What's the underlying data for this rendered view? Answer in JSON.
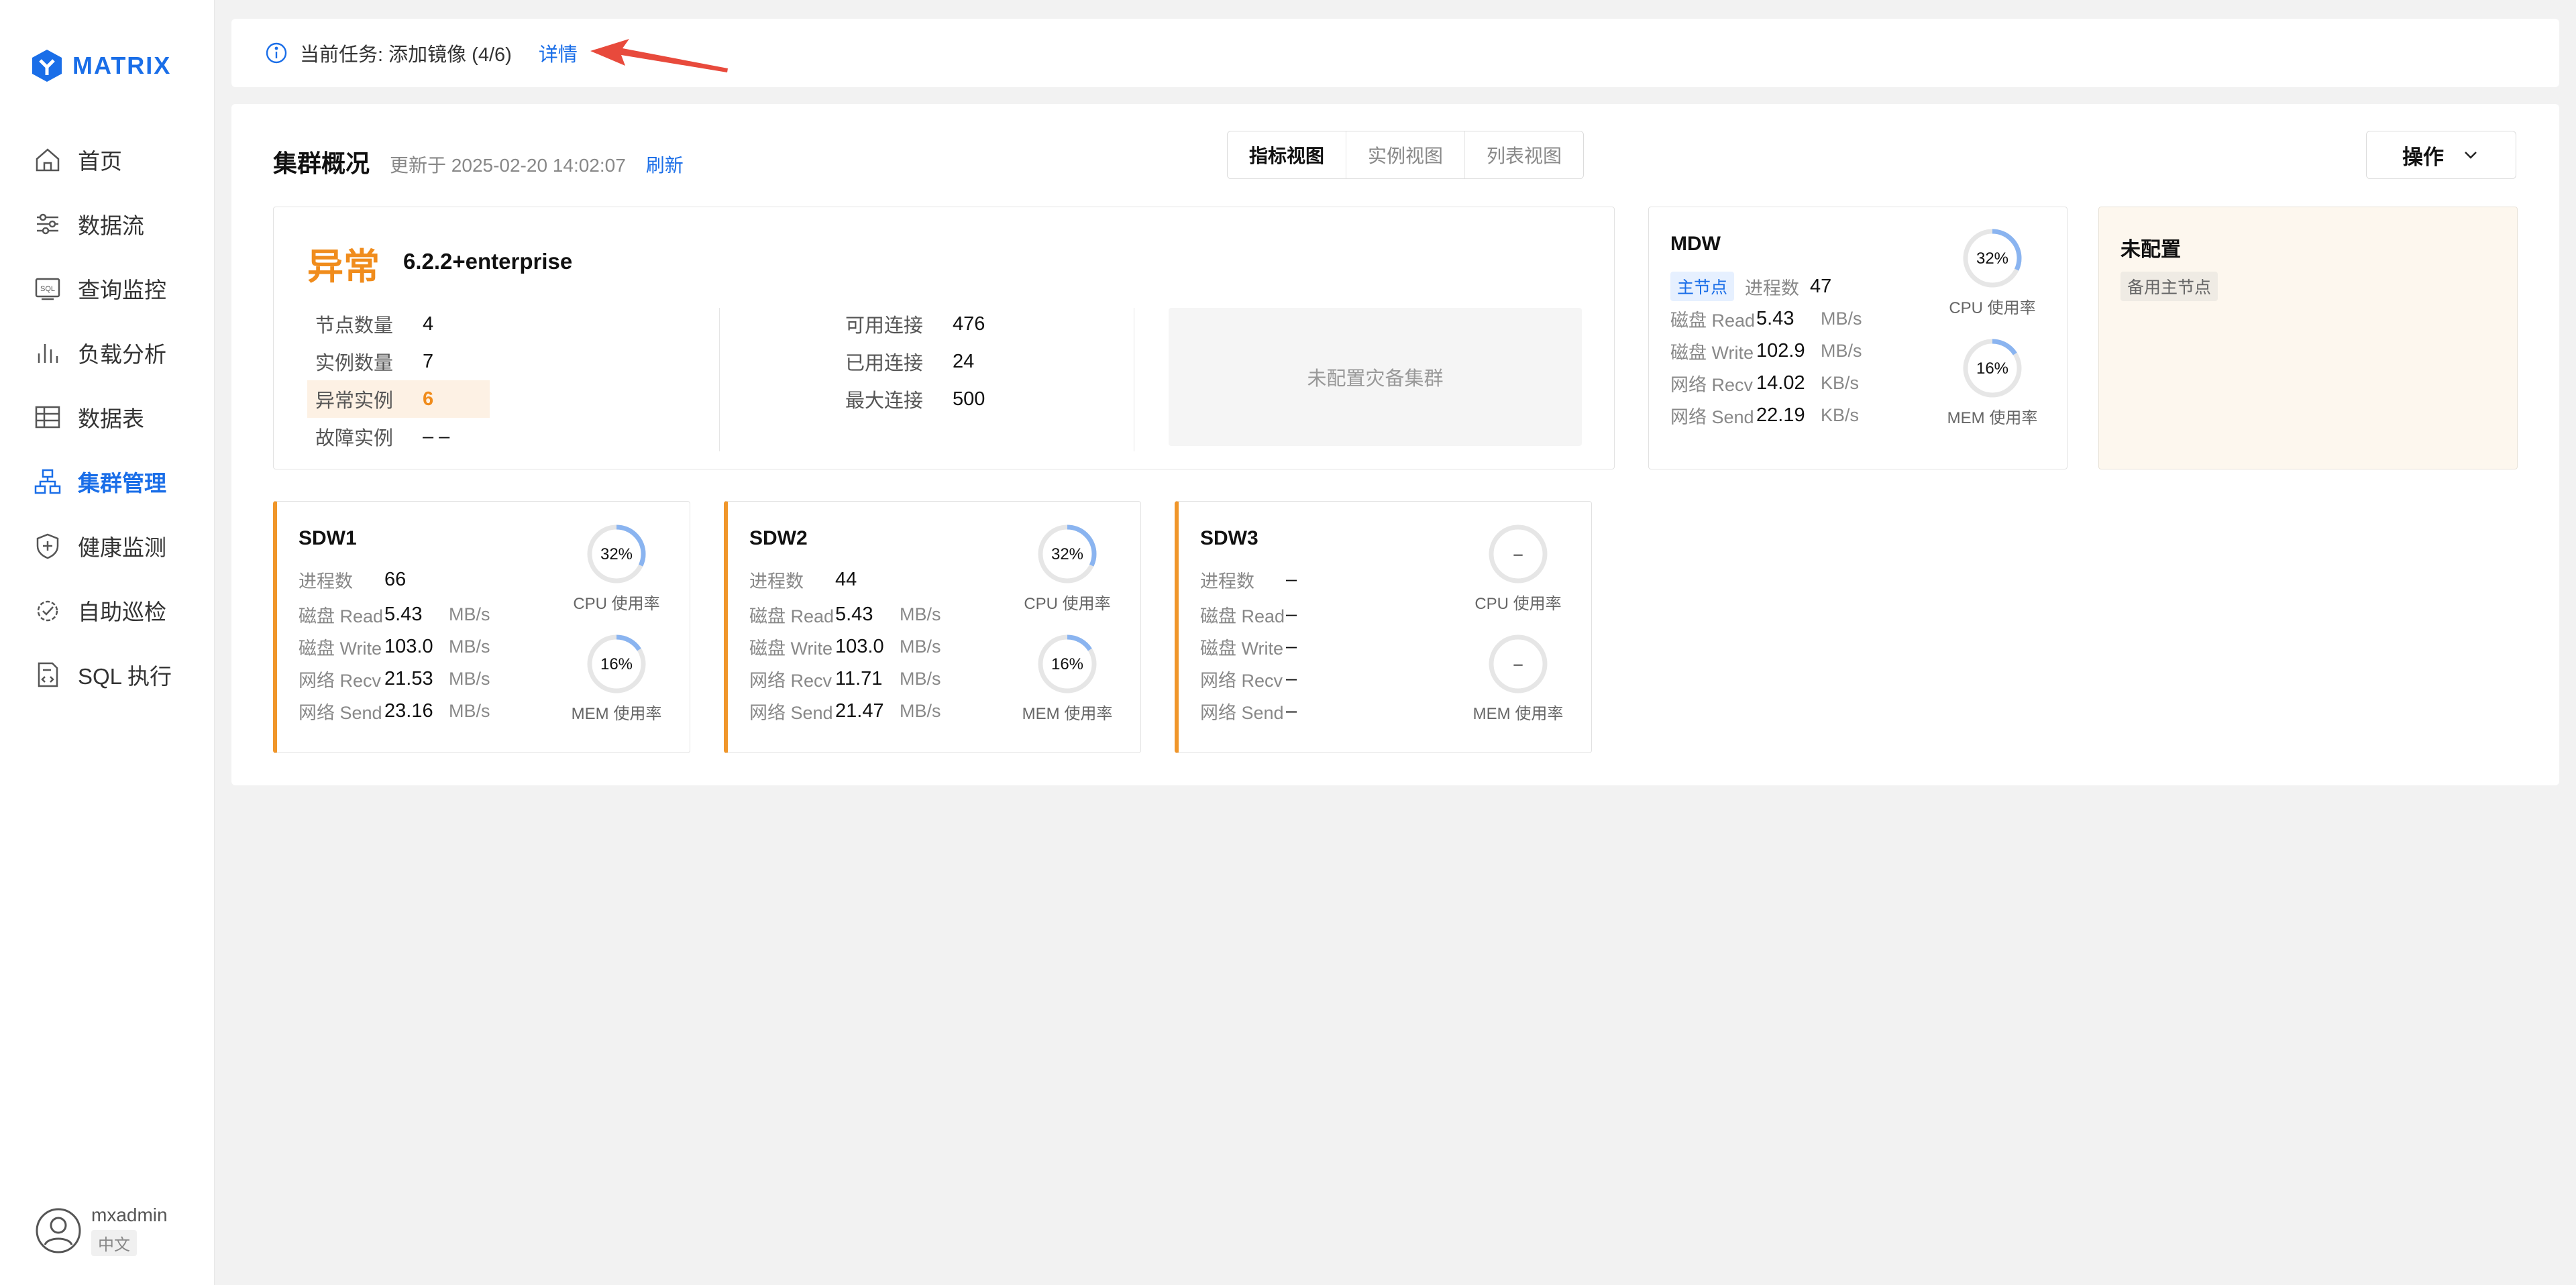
{
  "app": {
    "logo_text": "MATRIX"
  },
  "sidebar": {
    "items": [
      {
        "label": "首页",
        "icon": "home-icon"
      },
      {
        "label": "数据流",
        "icon": "sliders-icon"
      },
      {
        "label": "查询监控",
        "icon": "sql-icon"
      },
      {
        "label": "负载分析",
        "icon": "bar-chart-icon"
      },
      {
        "label": "数据表",
        "icon": "table-icon"
      },
      {
        "label": "集群管理",
        "icon": "cluster-icon",
        "active": true
      },
      {
        "label": "健康监测",
        "icon": "shield-icon"
      },
      {
        "label": "自助巡检",
        "icon": "inspect-icon"
      },
      {
        "label": "SQL 执行",
        "icon": "sql-file-icon"
      }
    ],
    "user": {
      "name": "mxadmin",
      "lang": "中文"
    }
  },
  "banner": {
    "text": "当前任务: 添加镜像 (4/6)",
    "link": "详情"
  },
  "overview": {
    "title": "集群概况",
    "updated": "更新于 2025-02-20 14:02:07",
    "refresh": "刷新",
    "views": [
      "指标视图",
      "实例视图",
      "列表视图"
    ],
    "active_view": "指标视图",
    "ops_label": "操作",
    "status": "异常",
    "status_color": "#f08c1c",
    "version": "6.2.2+enterprise",
    "stats_left": [
      {
        "k": "节点数量",
        "v": "4"
      },
      {
        "k": "实例数量",
        "v": "7"
      },
      {
        "k": "异常实例",
        "v": "6",
        "warn": true
      },
      {
        "k": "故障实例",
        "v": "– –"
      }
    ],
    "stats_right": [
      {
        "k": "可用连接",
        "v": "476"
      },
      {
        "k": "已用连接",
        "v": "24"
      },
      {
        "k": "最大连接",
        "v": "500"
      }
    ],
    "dr_text": "未配置灾备集群"
  },
  "mdw": {
    "name": "MDW",
    "tag": "主节点",
    "proc_label": "进程数",
    "proc": "47",
    "metrics": [
      {
        "k": "磁盘 Read",
        "v": "5.43",
        "u": "MB/s"
      },
      {
        "k": "磁盘 Write",
        "v": "102.9",
        "u": "MB/s"
      },
      {
        "k": "网络 Recv",
        "v": "14.02",
        "u": "KB/s"
      },
      {
        "k": "网络 Send",
        "v": "22.19",
        "u": "KB/s"
      }
    ],
    "cpu": {
      "text": "32%",
      "value": 0.32,
      "label": "CPU 使用率"
    },
    "mem": {
      "text": "16%",
      "value": 0.16,
      "label": "MEM 使用率"
    }
  },
  "standby": {
    "title": "未配置",
    "tag": "备用主节点"
  },
  "segments": [
    {
      "name": "SDW1",
      "proc_label": "进程数",
      "proc": "66",
      "metrics": [
        {
          "k": "磁盘 Read",
          "v": "5.43",
          "u": "MB/s"
        },
        {
          "k": "磁盘 Write",
          "v": "103.0",
          "u": "MB/s"
        },
        {
          "k": "网络 Recv",
          "v": "21.53",
          "u": "MB/s"
        },
        {
          "k": "网络 Send",
          "v": "23.16",
          "u": "MB/s"
        }
      ],
      "cpu": {
        "text": "32%",
        "value": 0.32,
        "label": "CPU 使用率"
      },
      "mem": {
        "text": "16%",
        "value": 0.16,
        "label": "MEM 使用率"
      }
    },
    {
      "name": "SDW2",
      "proc_label": "进程数",
      "proc": "44",
      "metrics": [
        {
          "k": "磁盘 Read",
          "v": "5.43",
          "u": "MB/s"
        },
        {
          "k": "磁盘 Write",
          "v": "103.0",
          "u": "MB/s"
        },
        {
          "k": "网络 Recv",
          "v": "11.71",
          "u": "MB/s"
        },
        {
          "k": "网络 Send",
          "v": "21.47",
          "u": "MB/s"
        }
      ],
      "cpu": {
        "text": "32%",
        "value": 0.32,
        "label": "CPU 使用率"
      },
      "mem": {
        "text": "16%",
        "value": 0.16,
        "label": "MEM 使用率"
      }
    },
    {
      "name": "SDW3",
      "proc_label": "进程数",
      "proc": "–",
      "metrics": [
        {
          "k": "磁盘 Read",
          "v": "–",
          "u": ""
        },
        {
          "k": "磁盘 Write",
          "v": "–",
          "u": ""
        },
        {
          "k": "网络 Recv",
          "v": "–",
          "u": ""
        },
        {
          "k": "网络 Send",
          "v": "–",
          "u": ""
        }
      ],
      "cpu": {
        "text": "–",
        "value": 0,
        "label": "CPU 使用率"
      },
      "mem": {
        "text": "–",
        "value": 0,
        "label": "MEM 使用率"
      }
    }
  ],
  "colors": {
    "accent": "#1a6ee8",
    "warning": "#f08c1c",
    "gauge": "#8ab4f0"
  }
}
